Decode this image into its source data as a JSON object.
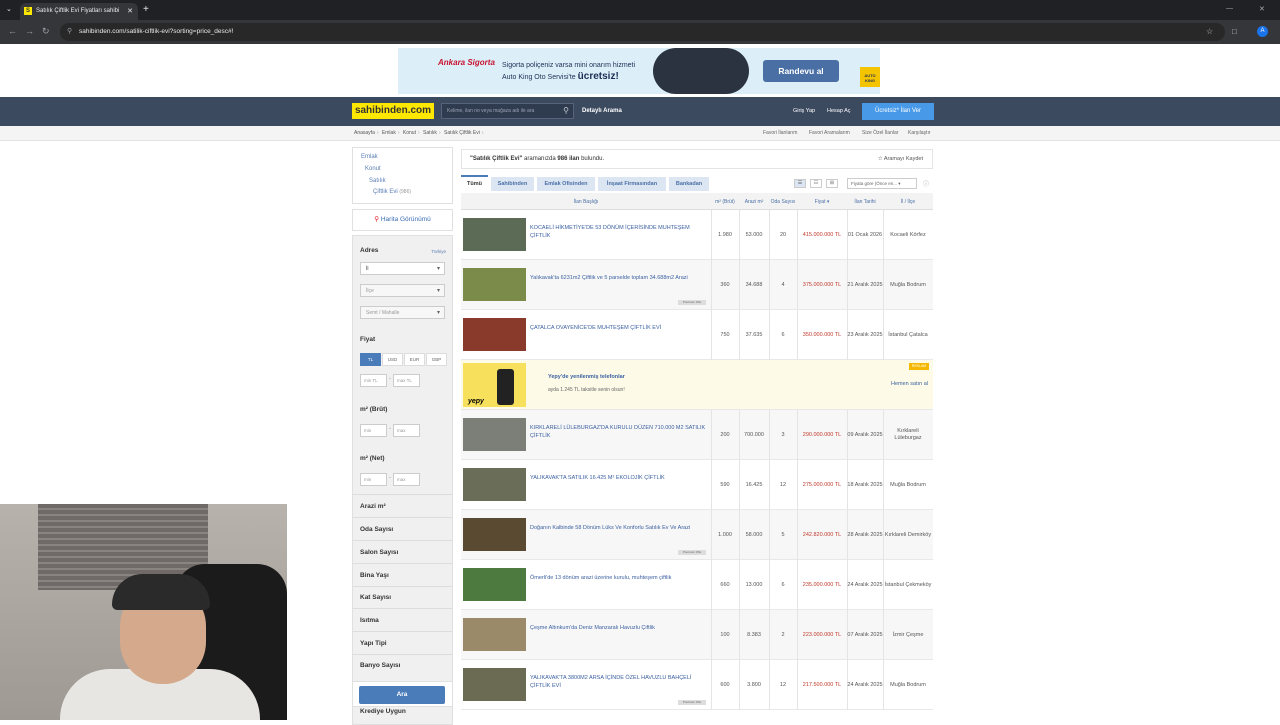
{
  "browser": {
    "tab_title": "Satılık Çiftlik Evi Fiyatları sahibi",
    "favicon": "S",
    "url": "sahibinden.com/satilik-ciftlik-evi?sorting=price_desc#!",
    "profile_initial": "A"
  },
  "ad": {
    "brand": "Ankara Sigorta",
    "line1": "Sigorta poliçeniz varsa mini onarım hizmeti",
    "line2": "Auto King Oto Servisi'te",
    "line2_bold": "ücretsiz!",
    "button": "Randevu al",
    "partner": "AUTO KING"
  },
  "header": {
    "logo": "sahibinden.com",
    "search_placeholder": "Kelime, ilan no veya mağaza adı ile ara",
    "detailed_search": "Detaylı Arama",
    "login": "Giriş Yap",
    "register": "Hesap Aç",
    "free_ad": "Ücretsiz* İlan Ver"
  },
  "breadcrumbs": [
    "Anasayfa",
    "Emlak",
    "Konut",
    "Satılık",
    "Satılık Çiftlik Evi"
  ],
  "subnav_links": [
    "Favori İlanlarım",
    "Favori Aramalarım",
    "Size Özel İlanlar",
    "Karşılaştır"
  ],
  "categories": [
    {
      "label": "Emlak",
      "count": ""
    },
    {
      "label": "Konut",
      "count": ""
    },
    {
      "label": "Satılık",
      "count": ""
    },
    {
      "label": "Çiftlik Evi",
      "count": "(986)"
    }
  ],
  "sidebar": {
    "map_view": "Harita Görünümü",
    "address_label": "Adres",
    "country": "Türkiye",
    "il": "İl",
    "ilce": "İlçe",
    "semt": "Semt / Mahalle",
    "price_label": "Fiyat",
    "currencies": [
      "TL",
      "USD",
      "EUR",
      "GBP"
    ],
    "min_tl": "min TL",
    "max_tl": "max TL",
    "m2_brut": "m² (Brüt)",
    "m2_net": "m² (Net)",
    "min": "min",
    "max": "max",
    "dash": "-",
    "filters": [
      "Arazi m²",
      "Oda Sayısı",
      "Salon Sayısı",
      "Bina Yaşı",
      "Kat Sayısı",
      "Isıtma",
      "Yapı Tipi",
      "Banyo Sayısı"
    ],
    "search_button": "Ara",
    "partial_filter": "Krediye Uygun"
  },
  "results": {
    "query": "\"Satılık Çiftlik Evi\"",
    "summary_middle": "aramanızda",
    "count": "986 ilan",
    "summary_end": "bulundu.",
    "save_search": "☆ Aramayı Kaydet",
    "tabs": [
      "Tümü",
      "Sahibinden",
      "Emlak Ofisinden",
      "İnşaat Firmasından",
      "Bankadan"
    ],
    "sort_label": "Fiyata göre (Önce en...",
    "columns": [
      "İlan Başlığı",
      "m² (Brüt)",
      "Arazi m²",
      "Oda Sayısı",
      "Fiyat ▾",
      "İlan Tarihi",
      "İl / İlçe"
    ]
  },
  "listings": [
    {
      "title": "KOCAELİ HİKMETİYE'DE 53 DÖNÜM İÇERİSİNDE MUHTEŞEM ÇİFTLİK",
      "m2": "1.980",
      "arazi": "53.000",
      "oda": "20",
      "price": "415.000.000 TL",
      "date": "01 Ocak 2026",
      "loc": "Kocaeli Körfez",
      "badge": "",
      "thumb": "#5b6b55"
    },
    {
      "title": "Yalıkavak'ta 6231m2 Çiftlik ve 5 parselde toplam 34.688m2 Arazi",
      "m2": "360",
      "arazi": "34.688",
      "oda": "4",
      "price": "375.000.000 TL",
      "date": "21 Aralık 2025",
      "loc": "Muğla Bodrum",
      "badge": "Premium Ofis",
      "thumb": "#7a8b4a"
    },
    {
      "title": "ÇATALCA OVAYENİCE'DE MUHTEŞEM ÇİFTLİK EVİ",
      "m2": "750",
      "arazi": "37.635",
      "oda": "6",
      "price": "350.000.000 TL",
      "date": "23 Aralık 2025",
      "loc": "İstanbul Çatalca",
      "badge": "",
      "thumb": "#8a3a2a"
    },
    {
      "title": "KIRKLARELİ LÜLEBURGAZ'DA KURULU DÜZEN 710.000 M2 SATILIK ÇİFTLİK",
      "m2": "200",
      "arazi": "700.000",
      "oda": "3",
      "price": "290.000.000 TL",
      "date": "09 Aralık 2025",
      "loc": "Kırklareli Lüleburgaz",
      "badge": "",
      "thumb": "#7c7f78"
    },
    {
      "title": "YALIKAVAK'TA SATILIK 16.425 M² EKOLOJİK ÇİFTLİK",
      "m2": "590",
      "arazi": "16.425",
      "oda": "12",
      "price": "275.000.000 TL",
      "date": "18 Aralık 2025",
      "loc": "Muğla Bodrum",
      "badge": "",
      "thumb": "#6a6e58"
    },
    {
      "title": "Doğanın Kalbinde 58 Dönüm Lüks Ve Konforlu Satılık Ev Ve Arazi",
      "m2": "1.000",
      "arazi": "58.000",
      "oda": "5",
      "price": "242.820.000 TL",
      "date": "28 Aralık 2025",
      "loc": "Kırklareli Demirköy",
      "badge": "Premium Ofis",
      "thumb": "#5a4a32"
    },
    {
      "title": "Ömerli'de 13 dönüm arazi üzerine kurulu, muhteşem çiftlik",
      "m2": "660",
      "arazi": "13.000",
      "oda": "6",
      "price": "235.000.000 TL",
      "date": "24 Aralık 2025",
      "loc": "İstanbul Çekmeköy",
      "badge": "",
      "thumb": "#4d7a3e"
    },
    {
      "title": "Çeşme Altınkum'da Deniz Manzaralı Havuzlu Çiftlik",
      "m2": "100",
      "arazi": "8.383",
      "oda": "2",
      "price": "223.000.000 TL",
      "date": "07 Aralık 2025",
      "loc": "İzmir Çeşme",
      "badge": "",
      "thumb": "#9a8a6a"
    },
    {
      "title": "YALIKAVAK'TA 3800M2 ARSA İÇİNDE ÖZEL HAVUZLU BAHÇELİ ÇİFTLİK EVİ",
      "m2": "600",
      "arazi": "3.800",
      "oda": "12",
      "price": "217.500.000 TL",
      "date": "24 Aralık 2025",
      "loc": "Muğla Bodrum",
      "badge": "Premium Ofis",
      "thumb": "#6b6a52"
    }
  ],
  "yepy": {
    "title": "Yepy'de yenilenmiş telefonlar",
    "subtitle": "ayda 1.245 TL taksitle senin olsun!",
    "link": "Hemen satın al",
    "badge": "REKLAM",
    "word": "yepy"
  }
}
